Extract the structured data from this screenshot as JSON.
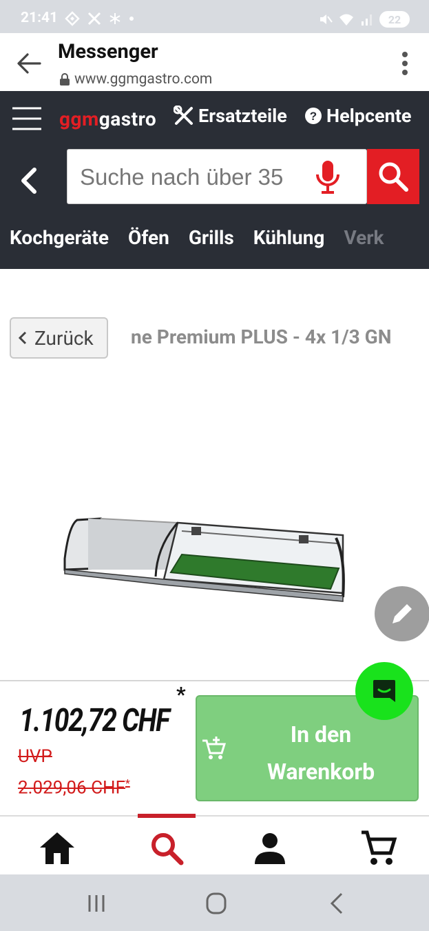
{
  "status_bar": {
    "time": "21:41",
    "battery": "22"
  },
  "browser": {
    "title": "Messenger",
    "url": "www.ggmgastro.com"
  },
  "site_header": {
    "logo_red": "ggm",
    "logo_white": "gastro",
    "ersatzteile": "Ersatzteile",
    "helpcenter": "Helpcente",
    "search_placeholder": "Suche nach über 35",
    "categories": [
      "Kochgeräte",
      "Öfen",
      "Grills",
      "Kühlung",
      "Verk"
    ]
  },
  "breadcrumb": {
    "back_label": "Zurück",
    "product_title": "ne Premium PLUS - 4x 1/3 GN"
  },
  "price_bar": {
    "price": "1.102,72 CHF",
    "price_star": "*",
    "uvp_label": "UVP",
    "uvp_price": "2.029,06 CHF",
    "uvp_star": "*",
    "cart_button": "In den Warenkorb"
  },
  "colors": {
    "brand_red": "#e31e24",
    "header_dark": "#2a2e36",
    "cart_green": "#7fcf7f",
    "chat_green": "#19e21c"
  },
  "bottom_nav": {
    "items": [
      "home-icon",
      "search-icon",
      "account-icon",
      "cart-icon"
    ],
    "active": "search-icon"
  }
}
